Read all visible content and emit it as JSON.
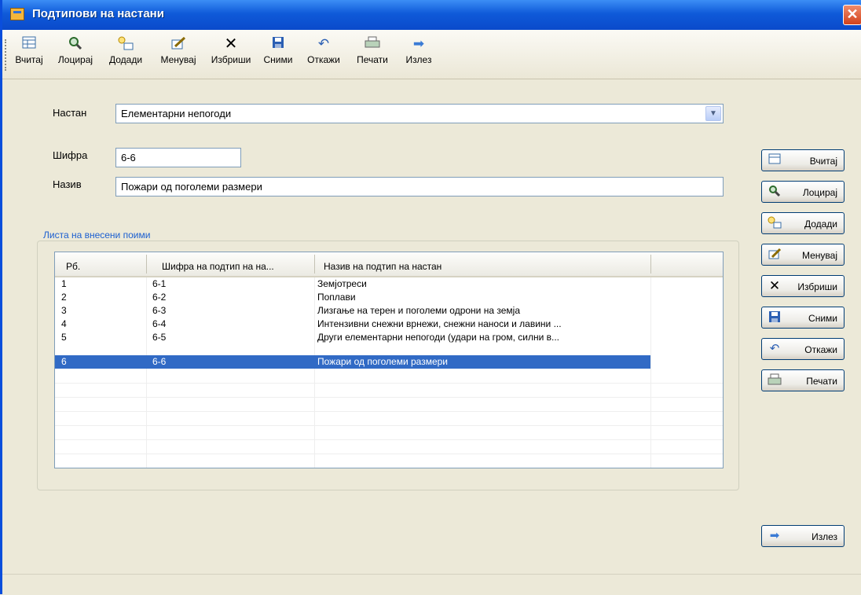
{
  "window": {
    "title": "Подтипови на настани"
  },
  "toolbar": {
    "items": [
      {
        "label": "Вчитај",
        "icon": "grid-icon"
      },
      {
        "label": "Лоцирај",
        "icon": "search-icon"
      },
      {
        "label": "Додади",
        "icon": "add-icon"
      },
      {
        "label": "Менувај",
        "icon": "edit-icon"
      },
      {
        "label": "Избриши",
        "icon": "delete-icon"
      },
      {
        "label": "Сними",
        "icon": "save-icon"
      },
      {
        "label": "Откажи",
        "icon": "undo-icon"
      },
      {
        "label": "Печати",
        "icon": "print-icon"
      },
      {
        "label": "Излез",
        "icon": "exit-arrow-icon"
      }
    ]
  },
  "form": {
    "nastan_label": "Настан",
    "nastan_value": "Елементарни непогоди",
    "sifra_label": "Шифра",
    "sifra_value": "6-6",
    "naziv_label": "Назив",
    "naziv_value": "Пожари од поголеми размери"
  },
  "list": {
    "group_title": "Листа на внесени поими",
    "columns": [
      "Рб.",
      "Шифра на подтип на на...",
      "Назив на подтип на настан"
    ],
    "rows": [
      {
        "rb": "1",
        "sifra": "6-1",
        "naziv": "Земјотреси"
      },
      {
        "rb": "2",
        "sifra": "6-2",
        "naziv": "Поплави"
      },
      {
        "rb": "3",
        "sifra": "6-3",
        "naziv": "Лизгање на терен и поголеми одрони на земја"
      },
      {
        "rb": "4",
        "sifra": "6-4",
        "naziv": "Интензивни снежни врнежи, снежни наноси и лавини ..."
      },
      {
        "rb": "5",
        "sifra": "6-5",
        "naziv": "Други елементарни непогоди (удари на гром, силни в..."
      },
      {
        "rb": "6",
        "sifra": "6-6",
        "naziv": "Пожари од поголеми размери"
      }
    ],
    "selected_index": 5
  },
  "side_buttons": {
    "load": "Вчитај",
    "locate": "Лоцирај",
    "add": "Додади",
    "edit": "Менувај",
    "delete": "Избриши",
    "save": "Сними",
    "cancel": "Откажи",
    "print": "Печати",
    "exit": "Излез"
  },
  "colors": {
    "titlebar": "#0A4ACB",
    "selection": "#316AC5",
    "group_title": "#1C5FD0"
  }
}
